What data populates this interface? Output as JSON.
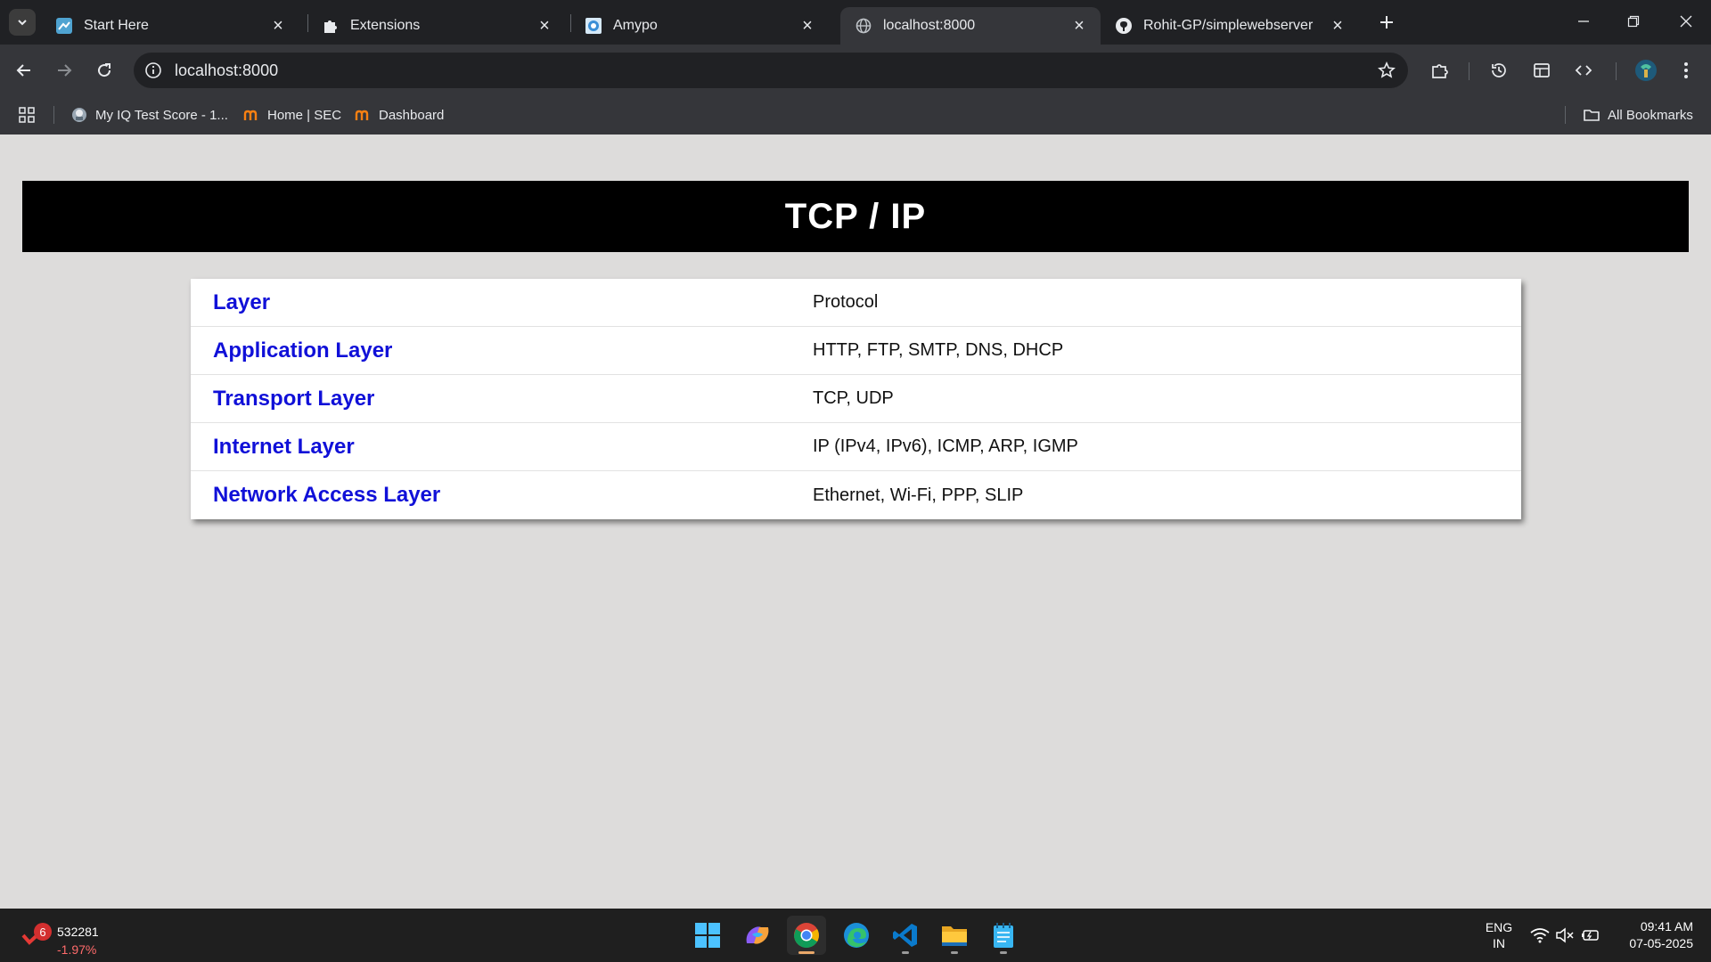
{
  "browser": {
    "tabs": [
      {
        "title": "Start Here",
        "icon": "start-here-favicon",
        "active": false
      },
      {
        "title": "Extensions",
        "icon": "puzzle-icon",
        "active": false
      },
      {
        "title": "Amypo",
        "icon": "amypo-favicon",
        "active": false
      },
      {
        "title": "localhost:8000",
        "icon": "globe-icon",
        "active": true
      },
      {
        "title": "Rohit-GP/simplewebserver",
        "icon": "github-icon",
        "active": false
      }
    ],
    "address": "localhost:8000",
    "bookmarks": [
      {
        "label": "My IQ Test Score - 1...",
        "icon": "iq-test-favicon"
      },
      {
        "label": "Home | SEC",
        "icon": "moodle-icon"
      },
      {
        "label": "Dashboard",
        "icon": "moodle-icon"
      }
    ],
    "all_bookmarks_label": "All Bookmarks"
  },
  "page": {
    "title": "TCP / IP",
    "rows": [
      {
        "layer": "Layer",
        "protocol": "Protocol"
      },
      {
        "layer": "Application Layer",
        "protocol": "HTTP, FTP, SMTP, DNS, DHCP"
      },
      {
        "layer": "Transport Layer",
        "protocol": "TCP, UDP"
      },
      {
        "layer": "Internet Layer",
        "protocol": "IP (IPv4, IPv6), ICMP, ARP, IGMP"
      },
      {
        "layer": "Network Access Layer",
        "protocol": "Ethernet, Wi-Fi, PPP, SLIP"
      }
    ],
    "colors": {
      "layer_text": "#1010d8",
      "header_bg": "#000000",
      "page_bg": "#dddcdb"
    }
  },
  "taskbar": {
    "stock": {
      "badge": "6",
      "value": "532281",
      "change": "-1.97%"
    },
    "apps": [
      "windows-start-icon",
      "copilot-icon",
      "chrome-icon",
      "edge-icon",
      "vscode-icon",
      "file-explorer-icon",
      "notepad-icon"
    ],
    "language": {
      "line1": "ENG",
      "line2": "IN"
    },
    "time": "09:41 AM",
    "date": "07-05-2025"
  }
}
